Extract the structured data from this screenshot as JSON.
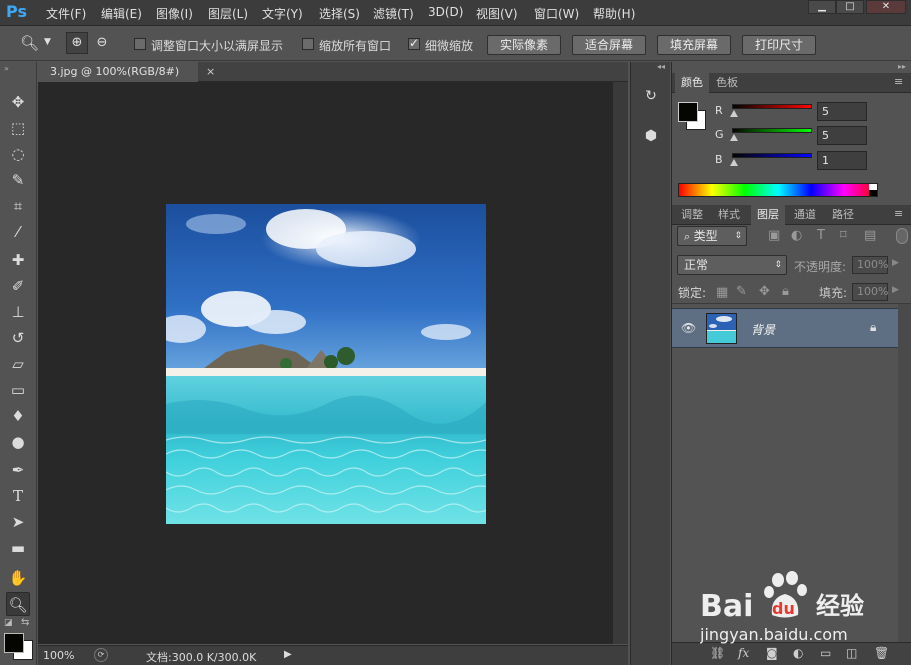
{
  "app": {
    "logo": "Ps"
  },
  "menu": [
    {
      "label": "文件(F)"
    },
    {
      "label": "编辑(E)"
    },
    {
      "label": "图像(I)"
    },
    {
      "label": "图层(L)"
    },
    {
      "label": "文字(Y)"
    },
    {
      "label": "选择(S)"
    },
    {
      "label": "滤镜(T)"
    },
    {
      "label": "3D(D)"
    },
    {
      "label": "视图(V)"
    },
    {
      "label": "窗口(W)"
    },
    {
      "label": "帮助(H)"
    }
  ],
  "window_controls": {
    "minimize": "▁",
    "maximize": "□",
    "close": "✕"
  },
  "options": {
    "tool_icon": "zoom-icon",
    "resize_windows_label": "调整窗口大小以满屏显示",
    "resize_windows_checked": false,
    "zoom_all_label": "缩放所有窗口",
    "zoom_all_checked": false,
    "scrubby_zoom_label": "细微缩放",
    "scrubby_zoom_checked": true,
    "buttons": {
      "actual_pixels": "实际像素",
      "fit_screen": "适合屏幕",
      "fill_screen": "填充屏幕",
      "print_size": "打印尺寸"
    }
  },
  "document": {
    "tab_title": "3.jpg @ 100%(RGB/8#)",
    "close_glyph": "×",
    "zoom": "100%",
    "doc_info": "文档:300.0 K/300.0K"
  },
  "color_panel": {
    "tabs": [
      {
        "label": "颜色",
        "active": true
      },
      {
        "label": "色板",
        "active": false
      }
    ],
    "foreground": "#050501",
    "background": "#ffffff",
    "channels": [
      {
        "label": "R",
        "value": "5",
        "color": "#ff0000"
      },
      {
        "label": "G",
        "value": "5",
        "color": "#00ff00"
      },
      {
        "label": "B",
        "value": "1",
        "color": "#0000ff"
      }
    ]
  },
  "layers_panel": {
    "tabs": [
      {
        "label": "调整",
        "active": false
      },
      {
        "label": "样式",
        "active": false
      },
      {
        "label": "图层",
        "active": true
      },
      {
        "label": "通道",
        "active": false
      },
      {
        "label": "路径",
        "active": false
      }
    ],
    "filter_label": "类型",
    "blend_mode": "正常",
    "opacity_label": "不透明度:",
    "opacity_value": "100%",
    "lock_label": "锁定:",
    "fill_label": "填充:",
    "fill_value": "100%",
    "layers": [
      {
        "name": "背景",
        "visible": true,
        "locked": true
      }
    ]
  },
  "watermark": {
    "brand": "Baidu",
    "brand_cn": "经验",
    "url": "jingyan.baidu.com"
  }
}
